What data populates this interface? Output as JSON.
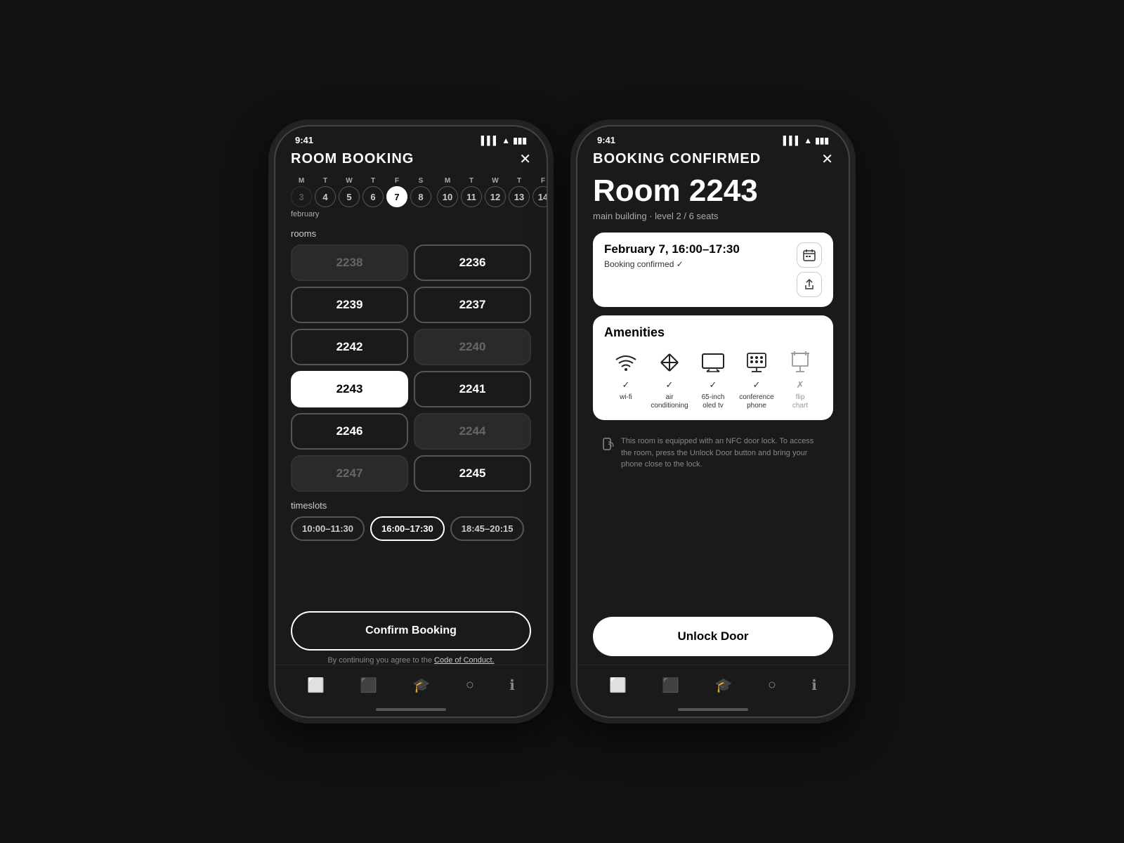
{
  "screen1": {
    "title": "ROOM BOOKING",
    "status_time": "9:41",
    "calendar": {
      "month": "february",
      "weeks": [
        {
          "days": [
            {
              "letter": "M",
              "num": "3",
              "state": "dim"
            },
            {
              "letter": "T",
              "num": "4",
              "state": "normal"
            },
            {
              "letter": "W",
              "num": "5",
              "state": "normal"
            },
            {
              "letter": "T",
              "num": "6",
              "state": "normal"
            },
            {
              "letter": "F",
              "num": "7",
              "state": "selected"
            },
            {
              "letter": "S",
              "num": "8",
              "state": "normal"
            }
          ]
        },
        {
          "days": [
            {
              "letter": "M",
              "num": "10",
              "state": "normal"
            },
            {
              "letter": "T",
              "num": "11",
              "state": "normal"
            },
            {
              "letter": "W",
              "num": "12",
              "state": "normal"
            },
            {
              "letter": "T",
              "num": "13",
              "state": "normal"
            },
            {
              "letter": "F",
              "num": "14",
              "state": "normal"
            }
          ]
        }
      ]
    },
    "rooms_label": "rooms",
    "rooms": [
      {
        "number": "2238",
        "state": "available"
      },
      {
        "number": "2236",
        "state": "bookable"
      },
      {
        "number": "2239",
        "state": "bookable"
      },
      {
        "number": "2237",
        "state": "bookable"
      },
      {
        "number": "2242",
        "state": "bookable"
      },
      {
        "number": "2240",
        "state": "available"
      },
      {
        "number": "2243",
        "state": "selected"
      },
      {
        "number": "2241",
        "state": "bookable"
      },
      {
        "number": "2246",
        "state": "bookable"
      },
      {
        "number": "2244",
        "state": "available"
      },
      {
        "number": "2247",
        "state": "available"
      },
      {
        "number": "2245",
        "state": "bookable"
      }
    ],
    "timeslots_label": "timeslots",
    "timeslots": [
      {
        "time": "10:00–11:30",
        "state": "normal"
      },
      {
        "time": "16:00–17:30",
        "state": "selected"
      },
      {
        "time": "18:45–20:15",
        "state": "normal"
      }
    ],
    "confirm_btn": "Confirm Booking",
    "terms_text": "By continuing you agree to the",
    "terms_link": "Code of Conduct.",
    "nav_items": [
      "square",
      "browser",
      "cap",
      "check",
      "info"
    ]
  },
  "screen2": {
    "title": "BOOKING CONFIRMED",
    "status_time": "9:41",
    "room_number": "Room 2243",
    "room_details": "main building · level 2 / 6 seats",
    "booking": {
      "datetime": "February 7, 16:00–17:30",
      "status": "Booking confirmed ✓"
    },
    "amenities": {
      "title": "Amenities",
      "items": [
        {
          "icon": "wifi",
          "check": "✓",
          "label": "wi-fi",
          "available": true
        },
        {
          "icon": "snowflake",
          "check": "✓",
          "label": "air\nconditioning",
          "available": true
        },
        {
          "icon": "tv",
          "check": "✓",
          "label": "65-inch\noled tv",
          "available": true
        },
        {
          "icon": "phone",
          "check": "✓",
          "label": "conference\nphone",
          "available": true
        },
        {
          "icon": "chart",
          "check": "✗",
          "label": "flip\nchart",
          "available": false
        }
      ]
    },
    "nfc_text": "This room is equipped with an NFC door lock. To access the room, press the Unlock Door button and bring your phone close to the lock.",
    "unlock_btn": "Unlock Door",
    "nav_items": [
      "square",
      "browser",
      "cap",
      "check",
      "info"
    ]
  },
  "icons": {
    "close": "✕",
    "wifi": "📶",
    "check": "✓",
    "cross": "✗"
  }
}
